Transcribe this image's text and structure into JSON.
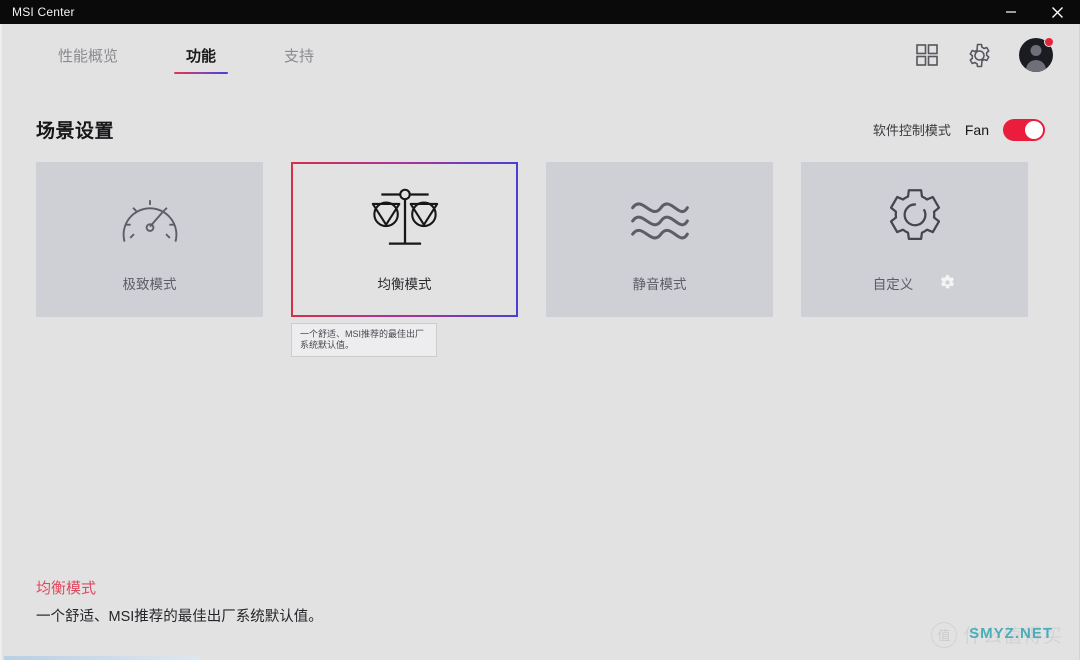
{
  "window": {
    "title": "MSI Center",
    "controls": {
      "minimize": "minimize-icon",
      "close": "close-icon"
    }
  },
  "nav": {
    "tabs": [
      {
        "label": "性能概览",
        "active": false
      },
      {
        "label": "功能",
        "active": true
      },
      {
        "label": "支持",
        "active": false
      }
    ],
    "icons": [
      {
        "name": "grid-apps-icon"
      },
      {
        "name": "gear-icon"
      },
      {
        "name": "avatar",
        "badge": true
      }
    ]
  },
  "section": {
    "title": "场景设置",
    "control_mode_label": "软件控制模式",
    "fan_label": "Fan",
    "fan_toggle_on": true
  },
  "cards": [
    {
      "label": "极致模式",
      "icon": "speedometer-icon",
      "selected": false,
      "has_gear": false
    },
    {
      "label": "均衡模式",
      "icon": "balance-scale-icon",
      "selected": true,
      "has_gear": false,
      "tooltip": "一个舒适、MSI推荐的最佳出厂系统默认值。"
    },
    {
      "label": "静音模式",
      "icon": "sound-waves-icon",
      "selected": false,
      "has_gear": false
    },
    {
      "label": "自定义",
      "icon": "gear-outline-icon",
      "selected": false,
      "has_gear": true
    }
  ],
  "footer": {
    "title": "均衡模式",
    "description": "一个舒适、MSI推荐的最佳出厂系统默认值。"
  },
  "watermark": {
    "badge": "值",
    "text": "什么值得买",
    "domain": "SMYZ.NET"
  },
  "colors": {
    "accent_red": "#ea1d3d",
    "accent_blue": "#4a3fd0",
    "page_bg": "#e2e2e2",
    "card_bg": "#cfd0d5",
    "titlebar_bg": "#0a0a0a"
  }
}
